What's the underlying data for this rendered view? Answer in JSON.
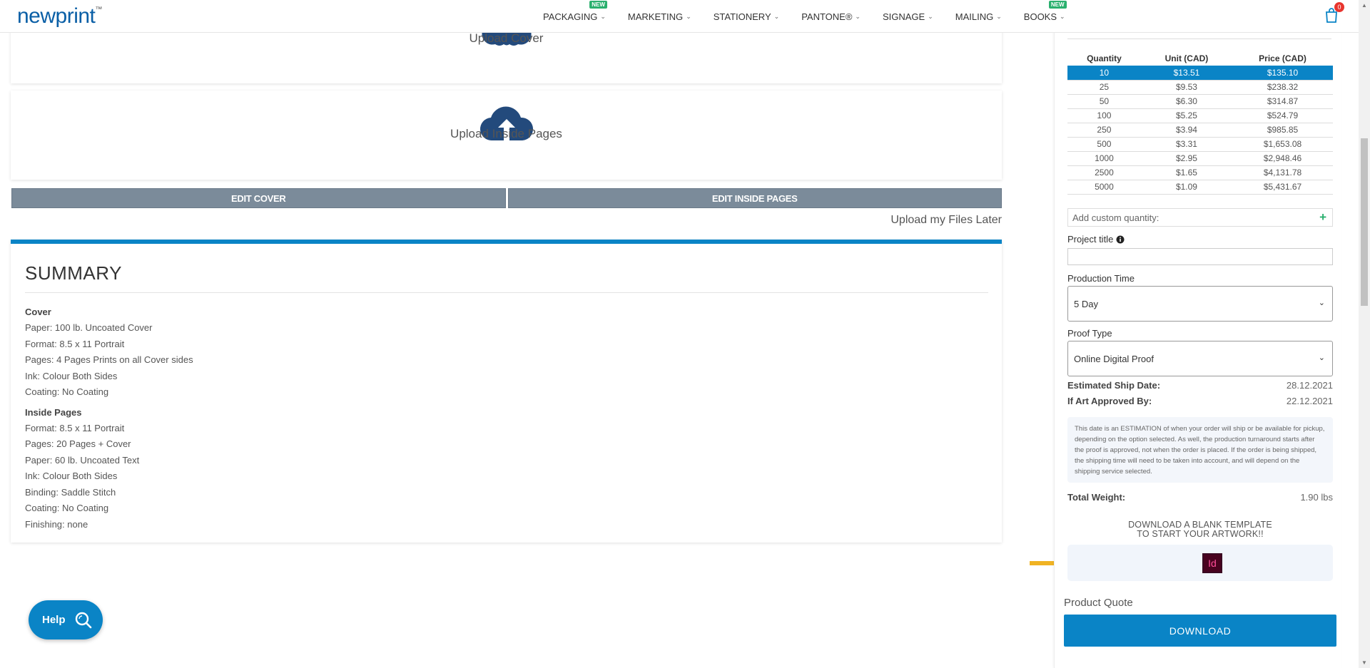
{
  "header": {
    "logo": "newprint",
    "logo_tm": "™",
    "nav": [
      {
        "label": "PACKAGING",
        "badge": "NEW"
      },
      {
        "label": "MARKETING",
        "badge": ""
      },
      {
        "label": "STATIONERY",
        "badge": ""
      },
      {
        "label": "PANTONE®",
        "badge": ""
      },
      {
        "label": "SIGNAGE",
        "badge": ""
      },
      {
        "label": "MAILING",
        "badge": ""
      },
      {
        "label": "BOOKS",
        "badge": "NEW"
      }
    ],
    "cart_count": "0"
  },
  "upload": {
    "cover_label": "Upload Cover",
    "inside_label": "Upload Inside Pages",
    "edit_cover": "EDIT COVER",
    "edit_inside": "EDIT INSIDE PAGES",
    "later": "Upload my Files Later"
  },
  "summary": {
    "title": "SUMMARY",
    "cover_heading": "Cover",
    "cover_lines": [
      "Paper: 100 lb. Uncoated Cover",
      "Format: 8.5 x 11 Portrait",
      "Pages: 4 Pages Prints on all Cover sides",
      "Ink: Colour Both Sides",
      "Coating: No Coating"
    ],
    "inside_heading": "Inside Pages",
    "inside_lines": [
      "Format: 8.5 x 11 Portrait",
      "Pages: 20 Pages + Cover",
      "Paper: 60 lb. Uncoated Text",
      "Ink: Colour Both Sides",
      "Binding: Saddle Stitch",
      "Coating: No Coating",
      "Finishing: none"
    ]
  },
  "help": {
    "label": "Help"
  },
  "pricing": {
    "columns": [
      "Quantity",
      "Unit (CAD)",
      "Price (CAD)"
    ],
    "rows": [
      [
        "10",
        "$13.51",
        "$135.10"
      ],
      [
        "25",
        "$9.53",
        "$238.32"
      ],
      [
        "50",
        "$6.30",
        "$314.87"
      ],
      [
        "100",
        "$5.25",
        "$524.79"
      ],
      [
        "250",
        "$3.94",
        "$985.85"
      ],
      [
        "500",
        "$3.31",
        "$1,653.08"
      ],
      [
        "1000",
        "$2.95",
        "$2,948.46"
      ],
      [
        "2500",
        "$1.65",
        "$4,131.78"
      ],
      [
        "5000",
        "$1.09",
        "$5,431.67"
      ]
    ],
    "selected_index": 0,
    "custom_qty_placeholder": "Add custom quantity:"
  },
  "form": {
    "project_title_label": "Project title",
    "project_title_value": "",
    "production_time_label": "Production Time",
    "production_time_value": "5 Day",
    "proof_type_label": "Proof Type",
    "proof_type_value": "Online Digital Proof",
    "ship_date_label": "Estimated Ship Date:",
    "ship_date_value": "28.12.2021",
    "art_approved_label": "If Art Approved By:",
    "art_approved_value": "22.12.2021",
    "note": "This date is an ESTIMATION of when your order will ship or be available for pickup, depending on the option selected. As well, the production turnaround starts after the proof is approved, not when the order is placed. If the order is being shipped, the shipping time will need to be taken into account, and will depend on the shipping service selected.",
    "weight_label": "Total Weight:",
    "weight_value": "1.90 lbs",
    "template_title_line1": "DOWNLOAD A BLANK TEMPLATE",
    "template_title_line2": "TO START YOUR ARTWORK!!",
    "indesign_icon_text": "Id",
    "quote_label": "Product Quote",
    "download_label": "DOWNLOAD"
  },
  "colors": {
    "brand_blue": "#0a84c6",
    "edit_button": "#7b8b9a",
    "badge_green": "#2ab06e",
    "pointer_arrow": "#f0b323",
    "indesign_pink": "#ff3a8a"
  }
}
